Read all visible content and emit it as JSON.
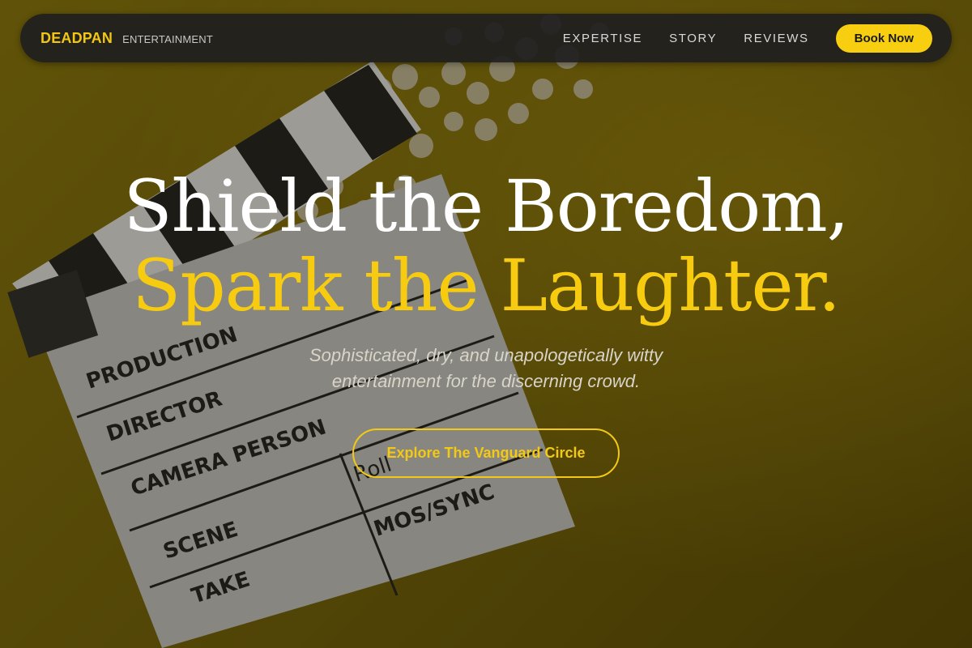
{
  "nav": {
    "brand": "DEADPAN",
    "brand_sub": "ENTERTAINMENT",
    "links": [
      "EXPERTISE",
      "STORY",
      "REVIEWS"
    ],
    "cta": "Book Now"
  },
  "hero": {
    "line1": "Shield the Boredom,",
    "line2": "Spark the Laughter.",
    "subtitle_line1": "Sophisticated, dry, and unapologetically witty",
    "subtitle_line2": "entertainment for the discerning crowd.",
    "cta": "Explore The Vanguard Circle"
  },
  "background": {
    "clapper_labels": [
      "PRODUCTION",
      "DIRECTOR",
      "CAMERA PERSON",
      "SCENE",
      "TAKE",
      "Roll",
      "MOS/SYNC"
    ]
  },
  "colors": {
    "accent": "#f7cc10",
    "nav_bg": "#1e1e1e"
  }
}
